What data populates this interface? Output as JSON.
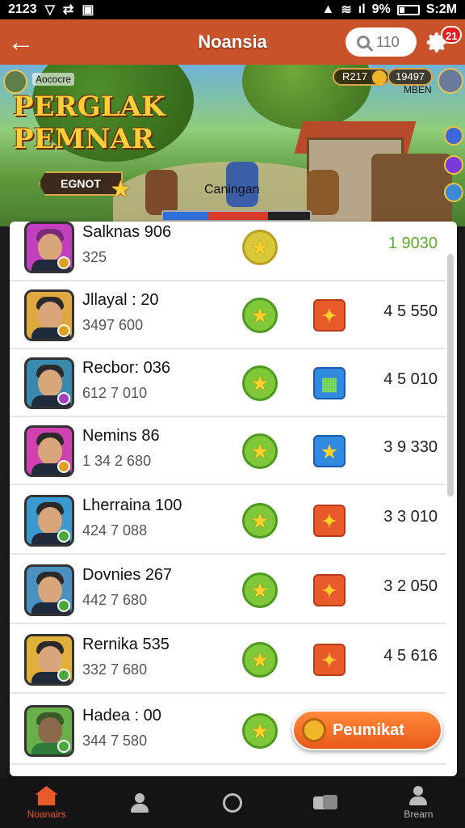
{
  "status_bar": {
    "time_left": "2123",
    "battery": "9%",
    "time_right": "S:2M"
  },
  "app_bar": {
    "title": "Noansia",
    "search_count": "110",
    "notification_count": "21"
  },
  "banner": {
    "sponsor": "Aococre",
    "logo_line1": "PERGLAK",
    "logo_line2": "PEMNAR",
    "resource1": "R217",
    "resource2": "19497",
    "resource2_sub": "MBEN",
    "action_tag": "EGNOT",
    "caption": "Caningan"
  },
  "leaderboard": [
    {
      "name": "Salknas 906",
      "value": "325",
      "score": "1 9030",
      "score_color": "#5cab2c",
      "badge": "none",
      "mini": "#e0a020"
    },
    {
      "name": "Jllayal : 20",
      "value": "3497 600",
      "score": "4 5 550",
      "badge": "orange",
      "mini": "#e0a020"
    },
    {
      "name": "Recbor: 036",
      "value": "612 7 010",
      "score": "4 5 010",
      "badge": "blue-calendar",
      "mini": "#a040c0"
    },
    {
      "name": "Nemins 86",
      "value": "1 34 2 680",
      "score": "3 9 330",
      "badge": "blue-star",
      "mini": "#e0a020"
    },
    {
      "name": "Lherraina 100",
      "value": "424 7 088",
      "score": "3 3 010",
      "badge": "orange",
      "mini": "#4aa83a"
    },
    {
      "name": "Dovnies 267",
      "value": "442 7 680",
      "score": "3 2 050",
      "badge": "orange",
      "mini": "#4aa83a"
    },
    {
      "name": "Rernika 535",
      "value": "332 7 680",
      "score": "4 5 616",
      "badge": "orange",
      "mini": "#4aa83a"
    },
    {
      "name": "Hadea : 00",
      "value": "344 7 580",
      "score": "",
      "badge": "none",
      "mini": "#4aa83a"
    }
  ],
  "cta": {
    "label": "Peumikat"
  },
  "navbar": {
    "items": [
      "Noanairs",
      "",
      "",
      "",
      "Brearn"
    ]
  },
  "colors": {
    "accent": "#c8532b",
    "cta": "#e85a1a",
    "star_bg": "#7ec83a"
  },
  "icons": {
    "back": "back-arrow-icon",
    "search": "search-icon",
    "settings": "gear-icon"
  }
}
